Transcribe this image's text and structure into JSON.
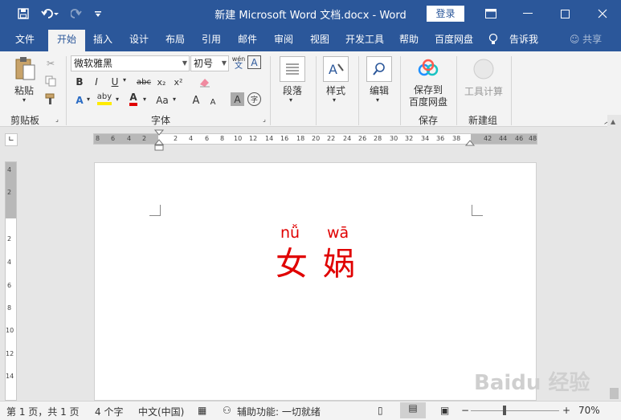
{
  "titlebar": {
    "title": "新建 Microsoft Word 文档.docx  -  Word",
    "login": "登录",
    "qa_icons": [
      "save-icon",
      "undo-icon",
      "redo-icon",
      "customize-icon"
    ]
  },
  "tabs": [
    "文件",
    "开始",
    "插入",
    "设计",
    "布局",
    "引用",
    "邮件",
    "审阅",
    "视图",
    "开发工具",
    "帮助",
    "百度网盘",
    "告诉我",
    "共享"
  ],
  "ribbon": {
    "clipboard": {
      "paste": "粘贴",
      "label": "剪贴板"
    },
    "font": {
      "font_name": "微软雅黑",
      "font_size": "初号",
      "wen_top": "wén",
      "wen_bottom": "文",
      "bold": "B",
      "italic": "I",
      "underline": "U",
      "strike": "abc",
      "subscript": "x₂",
      "superscript": "x²",
      "effects": "A",
      "highlight": "aby",
      "color": "A",
      "case": "Aa",
      "grow": "A",
      "shrink": "A",
      "char_shade": "A",
      "enclose": "字",
      "label": "字体"
    },
    "paragraph": {
      "label": "段落"
    },
    "styles": {
      "label": "样式"
    },
    "editing": {
      "label": "编辑"
    },
    "save": {
      "line1": "保存到",
      "line2": "百度网盘",
      "label": "保存"
    },
    "newgroup": {
      "tool": "工具计算",
      "label": "新建组"
    }
  },
  "ruler": {
    "h_ticks": [
      "8",
      "6",
      "4",
      "2",
      "2",
      "4",
      "6",
      "8",
      "10",
      "12",
      "14",
      "16",
      "18",
      "20",
      "22",
      "24",
      "26",
      "28",
      "30",
      "32",
      "34",
      "36",
      "38",
      "42",
      "44",
      "46",
      "48"
    ],
    "v_ticks": [
      "4",
      "2",
      "2",
      "4",
      "6",
      "8",
      "10",
      "12",
      "14"
    ]
  },
  "document": {
    "pinyin1": "nǚ",
    "pinyin2": "wā",
    "char1": "女",
    "char2": "娲"
  },
  "status": {
    "page": "第 1 页，共 1 页",
    "words": "4 个字",
    "lang": "中文(中国)",
    "accessibility": "辅助功能: 一切就绪",
    "zoom": "70%"
  },
  "watermark": "Baidu 经验",
  "colors": {
    "brand": "#2b579a",
    "pinyin_text": "#e00000"
  }
}
